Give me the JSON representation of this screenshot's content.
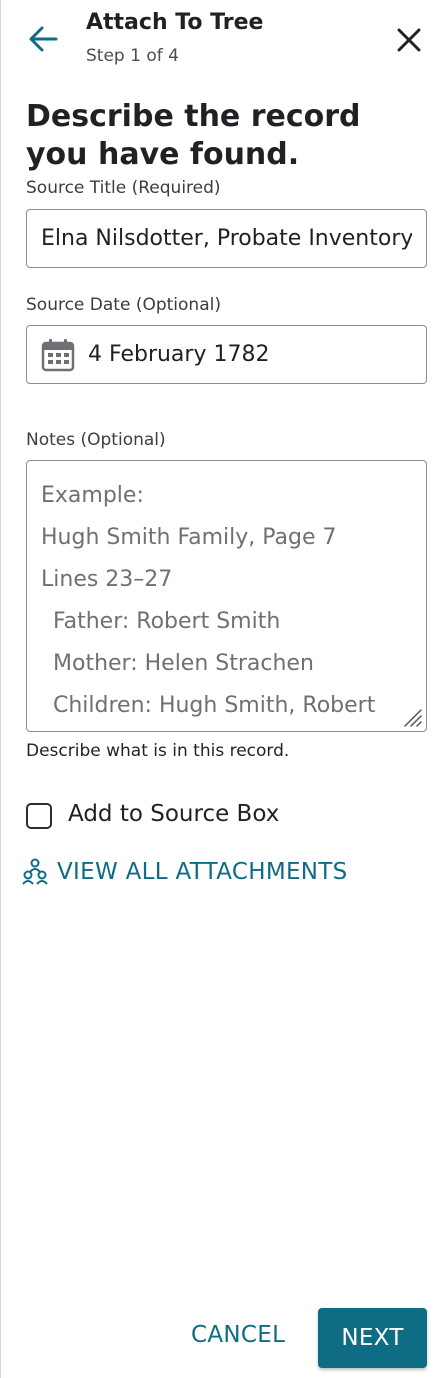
{
  "header": {
    "title": "Attach To Tree",
    "step": "Step 1 of 4",
    "back_icon": "arrow-left-icon",
    "close_icon": "close-icon"
  },
  "heading": "Describe the record you have found.",
  "source_title": {
    "label": "Source Title (Required)",
    "value": "Elna Nilsdotter, Probate Inventory"
  },
  "source_date": {
    "label": "Source Date (Optional)",
    "icon": "calendar-icon",
    "value": "4 February 1782"
  },
  "notes": {
    "label": "Notes (Optional)",
    "placeholder_lines": [
      "Example:",
      "Hugh Smith Family, Page 7",
      "Lines 23–27",
      "Father: Robert Smith",
      "Mother: Helen Strachen",
      "Children: Hugh Smith, Robert"
    ],
    "helper": "Describe what is in this record."
  },
  "source_box": {
    "label": "Add to Source Box",
    "checked": false
  },
  "view_all": {
    "icon": "people-icon",
    "label": "VIEW ALL ATTACHMENTS"
  },
  "actions": {
    "cancel": "CANCEL",
    "next": "NEXT"
  },
  "colors": {
    "accent": "#0f6c85",
    "text": "#1f2124",
    "placeholder": "#6d7075",
    "border": "#8a8d91"
  }
}
